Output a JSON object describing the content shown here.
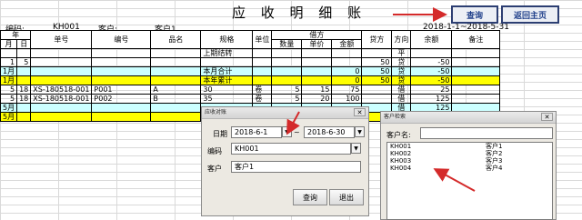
{
  "ledger": {
    "title": "应 收 明 细 账",
    "code_label": "编码:",
    "code_value": "KH001",
    "customer_label": "客户:",
    "customer_value": "客户1",
    "date_range": "2018-1-1~2018-5-31",
    "query_button": "查询",
    "home_button": "返回主页",
    "headers_top": {
      "year": "年",
      "voucher": "单号",
      "code": "编号",
      "name": "品名",
      "spec": "规格",
      "unit": "单位",
      "debit": "借方",
      "credit": "贷方",
      "direction": "方向",
      "balance": "余额",
      "remark": "备注"
    },
    "headers_sub": {
      "month": "月",
      "day": "日",
      "qty": "数量",
      "price": "单价",
      "amount": "金额"
    },
    "rows": [
      {
        "month": "",
        "day": "",
        "voucher": "",
        "code": "",
        "name": "",
        "spec": "上期结转",
        "unit": "",
        "qty": "",
        "price": "",
        "amount": "",
        "credit": "",
        "dir": "平",
        "balance": "",
        "remark": ""
      },
      {
        "month": "1",
        "day": "5",
        "voucher": "",
        "code": "",
        "name": "",
        "spec": "",
        "unit": "",
        "qty": "",
        "price": "",
        "amount": "",
        "credit": "50",
        "dir": "贷",
        "balance": "-50",
        "remark": ""
      },
      {
        "month": "1月",
        "day": "",
        "voucher": "",
        "code": "",
        "name": "",
        "spec": "本月合计",
        "unit": "",
        "qty": "",
        "price": "",
        "amount": "0",
        "credit": "50",
        "dir": "贷",
        "balance": "-50",
        "remark": ""
      },
      {
        "month": "1月",
        "day": "",
        "voucher": "",
        "code": "",
        "name": "",
        "spec": "本年累计",
        "unit": "",
        "qty": "",
        "price": "",
        "amount": "0",
        "credit": "50",
        "dir": "贷",
        "balance": "-50",
        "remark": ""
      },
      {
        "month": "5",
        "day": "18",
        "voucher": "XS-180518-001",
        "code": "P001",
        "name": "A",
        "spec": "30",
        "unit": "卷",
        "qty": "5",
        "price": "15",
        "amount": "75",
        "credit": "",
        "dir": "借",
        "balance": "25",
        "remark": ""
      },
      {
        "month": "5",
        "day": "18",
        "voucher": "XS-180518-001",
        "code": "P002",
        "name": "B",
        "spec": "35",
        "unit": "卷",
        "qty": "5",
        "price": "20",
        "amount": "100",
        "credit": "",
        "dir": "借",
        "balance": "125",
        "remark": ""
      },
      {
        "month": "5月",
        "day": "",
        "voucher": "",
        "code": "",
        "name": "",
        "spec": "",
        "unit": "",
        "qty": "",
        "price": "",
        "amount": "",
        "credit": "",
        "dir": "借",
        "balance": "125",
        "remark": ""
      },
      {
        "month": "5月",
        "day": "",
        "voucher": "",
        "code": "",
        "name": "",
        "spec": "",
        "unit": "",
        "qty": "",
        "price": "",
        "amount": "",
        "credit": "",
        "dir": "借",
        "balance": "125",
        "remark": ""
      }
    ],
    "row_styles": [
      "plain",
      "plain",
      "cyan",
      "yel",
      "plain",
      "plain",
      "cyan",
      "yel"
    ]
  },
  "query_dialog": {
    "title": "应收对账",
    "date_label": "日期",
    "date_from": "2018-6-1",
    "date_sep": "~",
    "date_to": "2018-6-30",
    "code_label": "编码",
    "code_value": "KH001",
    "customer_label": "客户",
    "customer_value": "客户1",
    "query_button": "查询",
    "exit_button": "退出"
  },
  "customer_dialog": {
    "title": "客户检索",
    "name_label": "客户名:",
    "name_value": "",
    "items": [
      {
        "code": "KH001",
        "name": "客户1"
      },
      {
        "code": "KH002",
        "name": "客户2"
      },
      {
        "code": "KH003",
        "name": "客户3"
      },
      {
        "code": "KH004",
        "name": "客户4"
      }
    ]
  },
  "colors": {
    "accent_red": "#d42a2a",
    "subtotal_cyan": "#ccffff",
    "total_yellow": "#ffff00",
    "button_text": "#1f3f8a"
  }
}
